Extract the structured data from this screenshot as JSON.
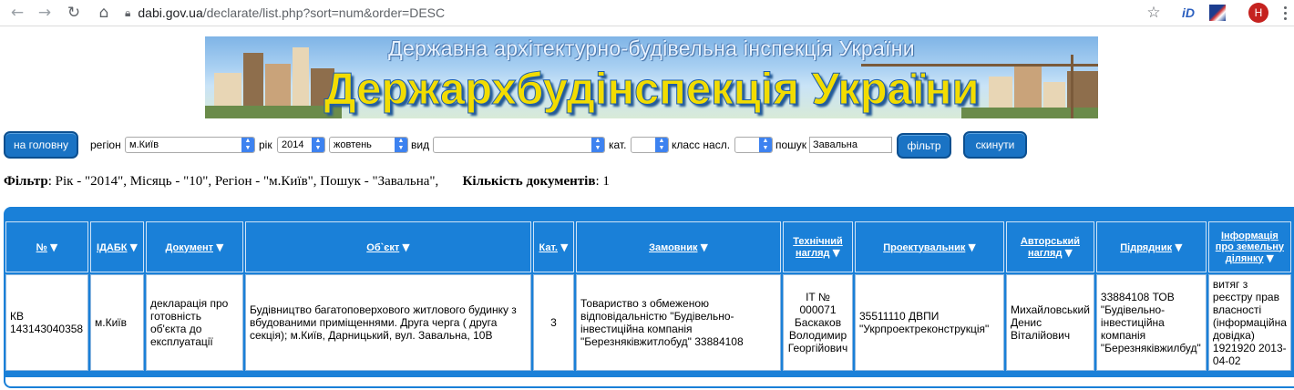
{
  "browser": {
    "url_domain": "dabi.gov.ua",
    "url_path": "/declarate/list.php?sort=num&order=DESC",
    "profile_initial": "H",
    "extension_1_label": "iD"
  },
  "banner": {
    "top_line": "Державна архітектурно-будівельна інспекція України",
    "main_line": "Держархбудінспекція України"
  },
  "toolbar": {
    "home_button": "на головну",
    "region_label": "регіон",
    "region_value": "м.Київ",
    "year_label": "рік",
    "year_value": "2014",
    "month_value": "жовтень",
    "type_label": "вид",
    "type_value": "",
    "cat_label": "кат.",
    "cat_value": "",
    "class_label": "класс насл.",
    "class_value": "",
    "search_label": "пошук",
    "search_value": "Завальна",
    "filter_button": "фільтр",
    "reset_button": "скинути"
  },
  "summary": {
    "filter_label": "Фільтр",
    "filter_text": ": Рік - \"2014\", Місяць - \"10\", Регіон - \"м.Київ\", Пошук - \"Завальна\",",
    "count_label": "Кількість документів",
    "count_text": ": 1"
  },
  "table": {
    "columns": [
      {
        "line1": "№",
        "line2": ""
      },
      {
        "line1": "ІДАБК",
        "line2": ""
      },
      {
        "line1": "Документ",
        "line2": ""
      },
      {
        "line1": "Об`єкт",
        "line2": ""
      },
      {
        "line1": "Кат.",
        "line2": ""
      },
      {
        "line1": "Замовник",
        "line2": ""
      },
      {
        "line1": "Технічний",
        "line2": "нагляд"
      },
      {
        "line1": "Проектувальник",
        "line2": ""
      },
      {
        "line1": "Авторський",
        "line2": "нагляд"
      },
      {
        "line1": "Підрядник",
        "line2": ""
      },
      {
        "line1": "Інформація",
        "line2": "про земельну",
        "line3": "ділянку"
      }
    ],
    "rows": [
      {
        "num": "КВ 143143040358",
        "idabk": "м.Київ",
        "document": "декларація про готовність об'єкта до експлуатації",
        "object": "Будівництво багатоповерхового житлового будинку з вбудованими приміщеннями. Друга черга ( друга секція); м.Київ, Дарницький, вул. Завальна, 10В",
        "cat": "3",
        "customer": "Товариство з обмеженою відповідальністю \"Будівельно-інвестиційна компанія \"Березняківжитлобуд\" 33884108",
        "tech_supervision": "ІТ № 000071 Баскаков Володимир Георгійович",
        "designer": "35511110 ДВПИ \"Укрпроектреконструкція\"",
        "author_supervision": "Михайловський Денис Віталійович",
        "contractor": "33884108 ТОВ \"Будівельно-інвестиційна компанія \"Березняківжилбуд\"",
        "land_info": "витяг з реєстру прав власності (інформаційна довідка) 1921920 2013-04-02"
      }
    ]
  },
  "colors": {
    "table_blue": "#1a80d8",
    "button_blue": "#1a73c4",
    "banner_yellow": "#f2dc00"
  }
}
